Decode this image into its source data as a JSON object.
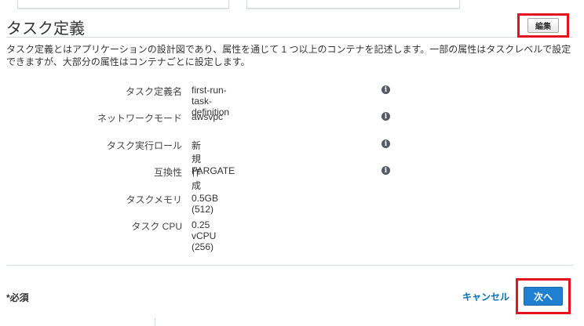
{
  "section": {
    "title": "タスク定義",
    "edit_label": "編集",
    "description": "タスク定義とはアプリケーションの設計図であり、属性を通じて 1 つ以上のコンテナを記述します。一部の属性はタスクレベルで設定できますが、大部分の属性はコンテナごとに設定します。"
  },
  "details": [
    {
      "label": "タスク定義名",
      "value": "first-run-task-definition",
      "info": true
    },
    {
      "label": "ネットワークモード",
      "value": "awsvpc",
      "info": true
    },
    {
      "label": "タスク実行ロール",
      "value": "新規作成",
      "info": true
    },
    {
      "label": "互換性",
      "value": "FARGATE",
      "info": true
    },
    {
      "label": "タスクメモリ",
      "value": "0.5GB (512)",
      "info": false
    },
    {
      "label": "タスク CPU",
      "value": "0.25 vCPU (256)",
      "info": false
    }
  ],
  "footer": {
    "required_note": "*必須",
    "cancel_label": "キャンセル",
    "next_label": "次へ"
  },
  "colors": {
    "link": "#0073bb",
    "primary_button": "#1f7fd1",
    "highlight_box": "#e3141f"
  }
}
